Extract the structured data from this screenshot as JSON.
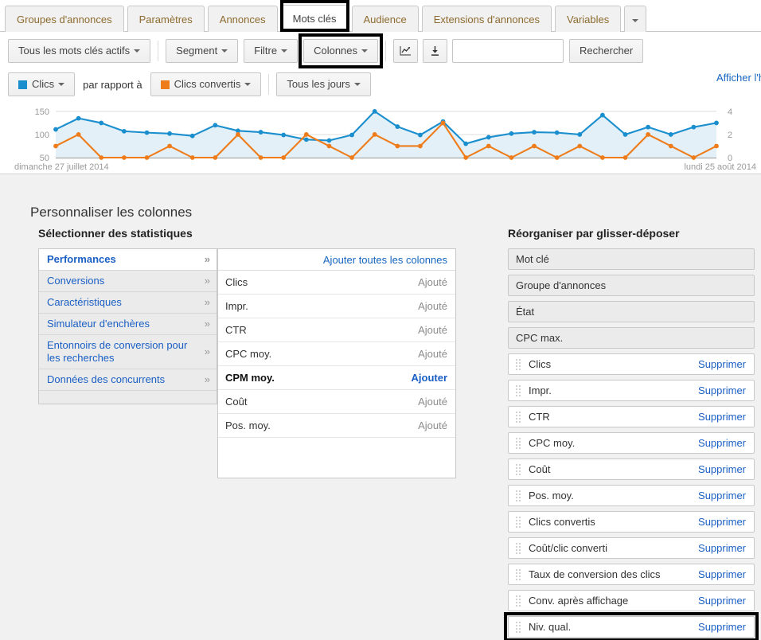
{
  "tabs": {
    "items": [
      {
        "label": "Groupes d'annonces",
        "active": false
      },
      {
        "label": "Paramètres",
        "active": false
      },
      {
        "label": "Annonces",
        "active": false
      },
      {
        "label": "Mots clés",
        "active": true
      },
      {
        "label": "Audience",
        "active": false
      },
      {
        "label": "Extensions d'annonces",
        "active": false
      },
      {
        "label": "Variables",
        "active": false
      }
    ],
    "more_label": ""
  },
  "toolbar": {
    "filter_status": "Tous les mots clés actifs",
    "segment": "Segment",
    "filter": "Filtre",
    "columns": "Colonnes",
    "chart_icon": "chart-icon",
    "download_icon": "download-icon",
    "search_value": "",
    "search_placeholder": "",
    "search_button": "Rechercher"
  },
  "metricbar": {
    "primary_metric": "Clics",
    "primary_color": "#1b8fce",
    "compare_text": "par rapport à",
    "secondary_metric": "Clics convertis",
    "secondary_color": "#ef7c1a",
    "granularity": "Tous les jours",
    "show_history_link": "Afficher l'historique"
  },
  "chart_data": {
    "type": "line",
    "title": "",
    "xlabel": "",
    "ylabel": "",
    "x_start_label": "dimanche 27 juillet 2014",
    "x_end_label": "lundi 25 août 2014",
    "left_axis": {
      "ticks": [
        50,
        100,
        150
      ],
      "ylim": [
        50,
        155
      ],
      "label": "Clics"
    },
    "right_axis": {
      "ticks": [
        0,
        2,
        4
      ],
      "ylim": [
        0,
        4.2
      ],
      "label": "Clics convertis"
    },
    "grid": true,
    "legend": "top-toolbar",
    "series": [
      {
        "name": "Clics",
        "color": "#1b8fce",
        "axis": "left",
        "values": [
          111,
          135,
          125,
          107,
          104,
          102,
          97,
          120,
          108,
          105,
          99,
          89,
          87,
          99,
          150,
          117,
          99,
          128,
          80,
          94,
          102,
          105,
          104,
          100,
          142,
          100,
          116,
          100,
          116,
          125
        ]
      },
      {
        "name": "Clics convertis",
        "color": "#ef7c1a",
        "axis": "right",
        "values": [
          1,
          2,
          0,
          0,
          0,
          1,
          0,
          0,
          2,
          0,
          0,
          2,
          1,
          0,
          2,
          1,
          1,
          3,
          0,
          1,
          0,
          1,
          0,
          1,
          0,
          0,
          2,
          1,
          0,
          1
        ]
      }
    ]
  },
  "customizer": {
    "title": "Personnaliser les colonnes",
    "select_stats_head": "Sélectionner des statistiques",
    "reorder_head": "Réorganiser par glisser-déposer",
    "categories": [
      {
        "label": "Performances",
        "selected": true
      },
      {
        "label": "Conversions",
        "selected": false
      },
      {
        "label": "Caractéristiques",
        "selected": false
      },
      {
        "label": "Simulateur d'enchères",
        "selected": false
      },
      {
        "label": "Entonnoirs de conversion pour les recherches",
        "selected": false
      },
      {
        "label": "Données des concurrents",
        "selected": false
      }
    ],
    "add_all_label": "Ajouter toutes les colonnes",
    "stats": [
      {
        "label": "Clics",
        "state": "Ajouté",
        "added": true
      },
      {
        "label": "Impr.",
        "state": "Ajouté",
        "added": true
      },
      {
        "label": "CTR",
        "state": "Ajouté",
        "added": true
      },
      {
        "label": "CPC moy.",
        "state": "Ajouté",
        "added": true
      },
      {
        "label": "CPM moy.",
        "state": "Ajouter",
        "added": false
      },
      {
        "label": "Coût",
        "state": "Ajouté",
        "added": true
      },
      {
        "label": "Pos. moy.",
        "state": "Ajouté",
        "added": true
      }
    ],
    "fixed_columns": [
      {
        "label": "Mot clé"
      },
      {
        "label": "Groupe d'annonces"
      },
      {
        "label": "État"
      },
      {
        "label": "CPC max."
      }
    ],
    "remove_label": "Supprimer",
    "selected_columns": [
      {
        "label": "Clics",
        "highlighted": false
      },
      {
        "label": "Impr.",
        "highlighted": false
      },
      {
        "label": "CTR",
        "highlighted": false
      },
      {
        "label": "CPC moy.",
        "highlighted": false
      },
      {
        "label": "Coût",
        "highlighted": false
      },
      {
        "label": "Pos. moy.",
        "highlighted": false
      },
      {
        "label": "Clics convertis",
        "highlighted": false
      },
      {
        "label": "Coût/clic converti",
        "highlighted": false
      },
      {
        "label": "Taux de conversion des clics",
        "highlighted": false
      },
      {
        "label": "Conv. après affichage",
        "highlighted": false
      },
      {
        "label": "Niv. qual.",
        "highlighted": true
      }
    ]
  }
}
